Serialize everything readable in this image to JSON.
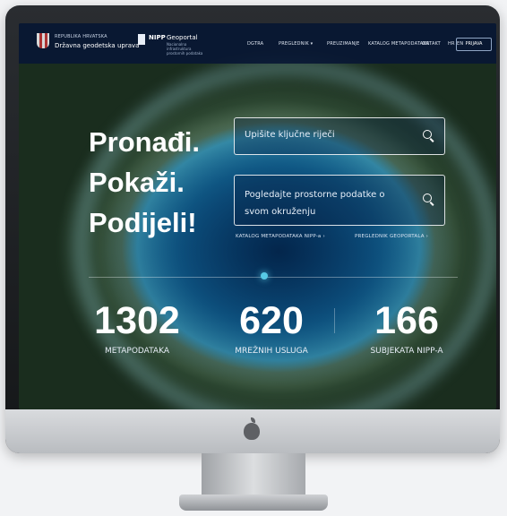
{
  "header": {
    "org_line1": "REPUBLIKA HRVATSKA",
    "org_line2": "Državna geodetska uprava",
    "portal_abbr": "NIPP",
    "portal_name": "Geoportal",
    "portal_sub": "Nacionalna infrastruktura prostornih podataka",
    "nav": [
      "DGTRA",
      "PREGLEDNIK ▾",
      "PREUZIMANJE",
      "KATALOG METAPODATAKA",
      "ONTAKT",
      "HR",
      "EN"
    ],
    "login_label": "PRIJAVA"
  },
  "hero": {
    "line1": "Pronađi.",
    "line2": "Pokaži.",
    "line3": "Podijeli!"
  },
  "search": {
    "keywords_placeholder": "Upišite ključne riječi",
    "map_placeholder": "Pogledajte prostorne podatke o svom okruženju"
  },
  "links": {
    "catalog": "KATALOG METAPODATAKA NIPP-a ›",
    "viewer": "PREGLEDNIK GEOPORTALA ›"
  },
  "stats": [
    {
      "value": "1302",
      "label": "METAPODATAKA"
    },
    {
      "value": "620",
      "label": "MREŽNIH USLUGA"
    },
    {
      "value": "166",
      "label": "SUBJEKATA NIPP-A"
    }
  ],
  "colors": {
    "topbar": "#081634",
    "accent_marker": "#57c9e5",
    "lagoon_deep": "#032348",
    "bezel": "#1c1e21"
  },
  "icons": {
    "search_keywords": "search-icon",
    "search_map": "search-icon",
    "device_logo": "apple-icon"
  }
}
